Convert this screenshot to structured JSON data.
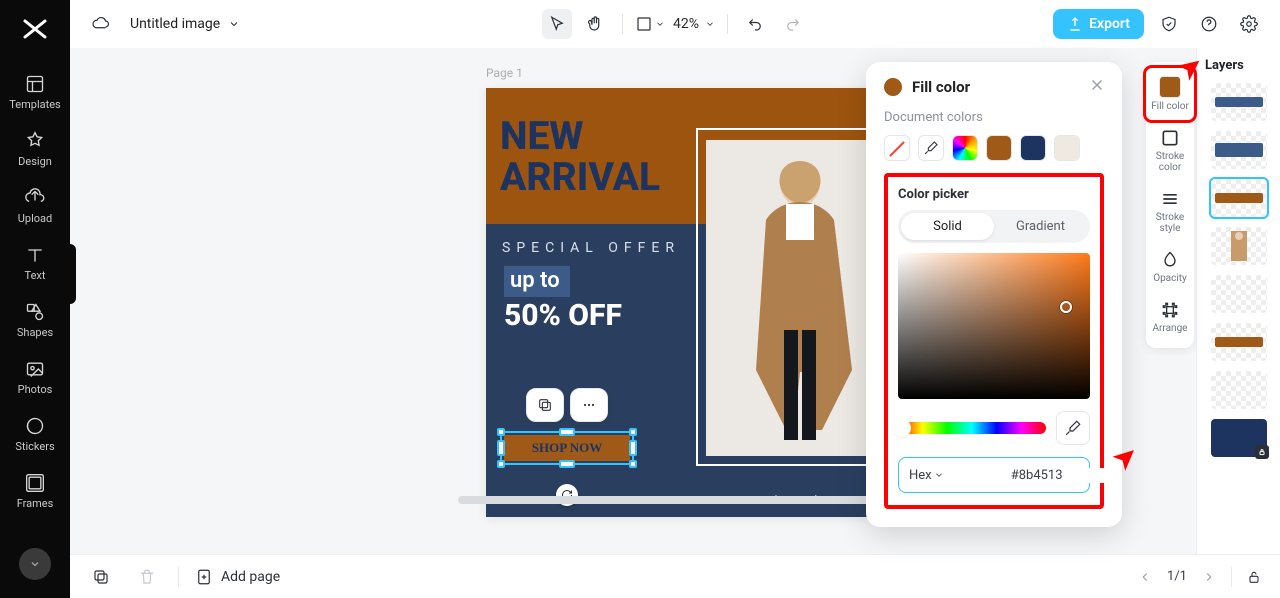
{
  "topbar": {
    "doc_title": "Untitled image",
    "zoom": "42%",
    "export": "Export"
  },
  "rail": {
    "items": [
      {
        "key": "templates",
        "label": "Templates"
      },
      {
        "key": "design",
        "label": "Design"
      },
      {
        "key": "upload",
        "label": "Upload"
      },
      {
        "key": "text",
        "label": "Text"
      },
      {
        "key": "shapes",
        "label": "Shapes"
      },
      {
        "key": "photos",
        "label": "Photos"
      },
      {
        "key": "stickers",
        "label": "Stickers"
      },
      {
        "key": "frames",
        "label": "Frames"
      }
    ]
  },
  "page": {
    "label": "Page 1"
  },
  "canvas": {
    "headline_l1": "NEW",
    "headline_l2": "ARRIVAL",
    "special": "SPECIAL OFFER",
    "upto": "up to",
    "off": "50% OFF",
    "shopnow": "SHOP NOW",
    "url": "www.brandname.com"
  },
  "props": {
    "items": [
      {
        "key": "fillcolor",
        "label": "Fill color"
      },
      {
        "key": "strokecolor",
        "label": "Stroke color"
      },
      {
        "key": "strokestyle",
        "label": "Stroke style"
      },
      {
        "key": "opacity",
        "label": "Opacity"
      },
      {
        "key": "arrange",
        "label": "Arrange"
      }
    ],
    "fill_swatch": "#a05a17"
  },
  "popover": {
    "title": "Fill color",
    "doc_colors_label": "Document colors",
    "doc_colors": [
      "none",
      "eyedrop",
      "rainbow",
      "#a05a17",
      "#1d3461",
      "#efe9e2"
    ],
    "picker_title": "Color picker",
    "tab_solid": "Solid",
    "tab_gradient": "Gradient",
    "hex_mode": "Hex",
    "hex_value": "#8b4513"
  },
  "layers": {
    "title": "Layers",
    "thumbs": [
      {
        "type": "bar",
        "color": "#3d5b89",
        "pos": "mid"
      },
      {
        "type": "bar",
        "color": "#3d5b89",
        "pos": "mid-wide"
      },
      {
        "type": "bar",
        "color": "#a05a17",
        "pos": "mid",
        "selected": true
      },
      {
        "type": "photo"
      },
      {
        "type": "empty"
      },
      {
        "type": "bar",
        "color": "#a05a17",
        "pos": "mid"
      },
      {
        "type": "empty"
      },
      {
        "type": "full",
        "color": "#1d3461",
        "locked": true
      }
    ]
  },
  "status": {
    "add_page": "Add page",
    "page_indicator": "1/1"
  }
}
